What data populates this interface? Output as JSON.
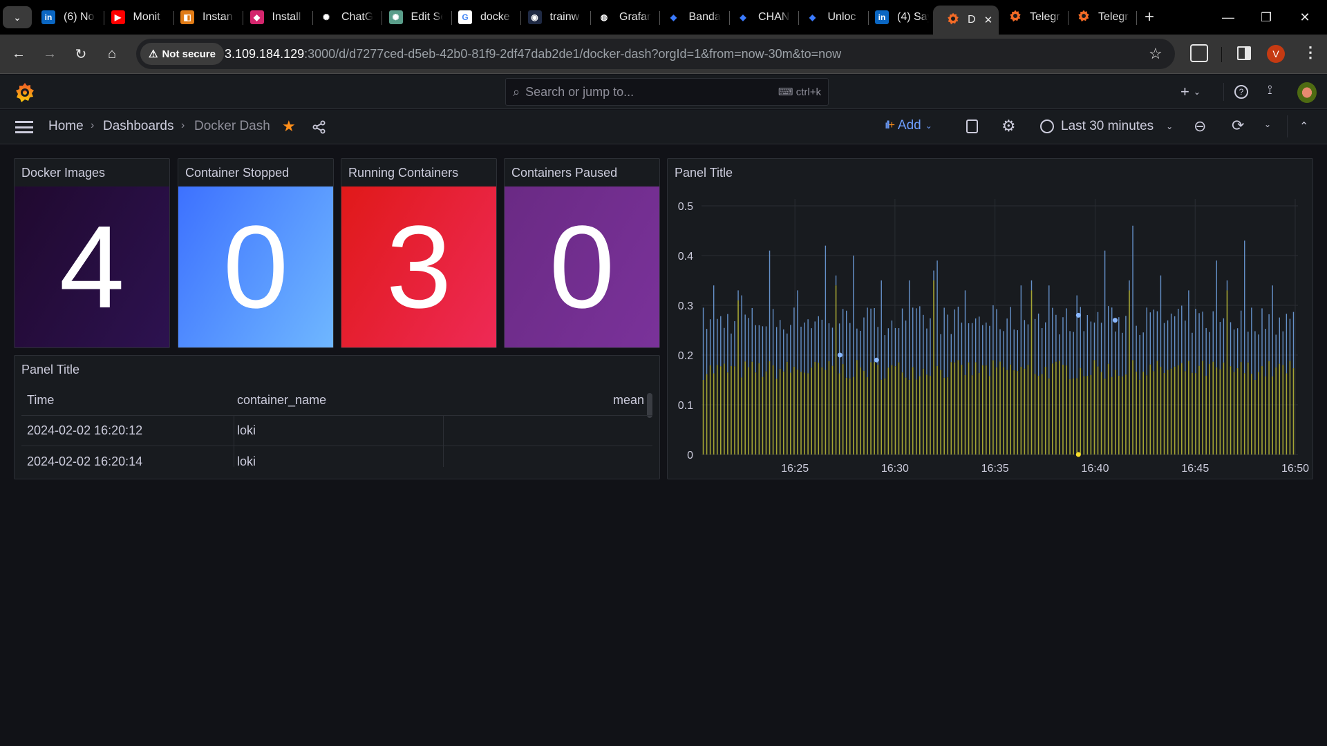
{
  "browser": {
    "tabs": [
      {
        "icon": "linkedin-icon",
        "icon_text": "in",
        "icon_color": "#0a66c2",
        "label": "(6) No"
      },
      {
        "icon": "youtube-icon",
        "icon_text": "▶",
        "icon_color": "#ff0000",
        "label": "Monit"
      },
      {
        "icon": "aws-icon",
        "icon_text": "◧",
        "icon_color": "#e07b16",
        "label": "Instan"
      },
      {
        "icon": "gem-icon",
        "icon_text": "◆",
        "icon_color": "#d4266d",
        "label": "Install"
      },
      {
        "icon": "chatgpt-icon",
        "icon_text": "✺",
        "icon_color": "#000000",
        "label": "ChatG"
      },
      {
        "icon": "chatgpt-icon",
        "icon_text": "✺",
        "icon_color": "#5a9e8a",
        "label": "Edit Se"
      },
      {
        "icon": "google-icon",
        "icon_text": "G",
        "icon_color": "#ffffff",
        "label": "docke"
      },
      {
        "icon": "docker-icon",
        "icon_text": "◉",
        "icon_color": "#1f2a44",
        "label": "trainw"
      },
      {
        "icon": "globe-icon",
        "icon_text": "◍",
        "icon_color": "#000000",
        "label": "Grafan"
      },
      {
        "icon": "diamond-icon",
        "icon_text": "◆",
        "icon_color": "#000000",
        "label": "Banda"
      },
      {
        "icon": "diamond-icon",
        "icon_text": "◆",
        "icon_color": "#000000",
        "label": "CHAN"
      },
      {
        "icon": "diamond-icon",
        "icon_text": "◆",
        "icon_color": "#000000",
        "label": "Unloc"
      },
      {
        "icon": "linkedin-icon",
        "icon_text": "in",
        "icon_color": "#0a66c2",
        "label": "(4) Say"
      }
    ],
    "active_tab": {
      "icon": "grafana-icon",
      "label": "D"
    },
    "right_tabs": [
      {
        "icon": "grafana-icon",
        "label": "Telegr"
      },
      {
        "icon": "grafana-icon",
        "label": "Telegr"
      }
    ],
    "security_label": "Not secure",
    "url_host": "3.109.184.129",
    "url_rest": ":3000/d/d7277ced-d5eb-42b0-81f9-2df47dab2de1/docker-dash?orgId=1&from=now-30m&to=now",
    "profile_initial": "V"
  },
  "grafana": {
    "search_placeholder": "Search or jump to...",
    "search_shortcut": "ctrl+k",
    "breadcrumbs": [
      "Home",
      "Dashboards",
      "Docker Dash"
    ],
    "add_label": "Add",
    "time_range": "Last 30 minutes",
    "star_color": "#ff8f1a"
  },
  "stats": [
    {
      "title": "Docker Images",
      "value": "4",
      "bg_from": "#20092f",
      "bg_to": "#2d1250"
    },
    {
      "title": "Container Stopped",
      "value": "0",
      "bg_from": "#3d71ff",
      "bg_to": "#6fb7ff"
    },
    {
      "title": "Running Containers",
      "value": "3",
      "bg_from": "#e01919",
      "bg_to": "#ee2a56"
    },
    {
      "title": "Containers Paused",
      "value": "0",
      "bg_from": "#6a2a84",
      "bg_to": "#7a329a"
    }
  ],
  "table": {
    "title": "Panel Title",
    "columns": [
      "Time",
      "container_name",
      "mean"
    ],
    "rows": [
      [
        "2024-02-02 16:20:12",
        "loki",
        ""
      ],
      [
        "2024-02-02 16:20:14",
        "loki",
        ""
      ]
    ]
  },
  "chart_data": {
    "type": "bar",
    "title": "Panel Title",
    "xlabel": "",
    "ylabel": "",
    "ylim": [
      0,
      0.5
    ],
    "yticks": [
      "0",
      "0.1",
      "0.2",
      "0.3",
      "0.4",
      "0.5"
    ],
    "xticks": [
      "16:25",
      "16:30",
      "16:35",
      "16:40",
      "16:45",
      "16:50"
    ],
    "x_range": [
      "16:20:20",
      "16:50:00"
    ],
    "grid": true,
    "legend": "none",
    "series": [
      {
        "name": "series-blue",
        "color": "#73a6e8",
        "style": "stacked-top",
        "typical_range": [
          0.24,
          0.3
        ],
        "peaks": [
          0.34,
          0.32,
          0.41,
          0.33,
          0.42,
          0.4,
          0.35,
          0.35,
          0.39,
          0.33,
          0.3,
          0.34,
          0.34,
          0.32,
          0.41,
          0.46,
          0.36,
          0.33,
          0.39,
          0.43,
          0.34
        ]
      },
      {
        "name": "series-yellow",
        "color": "#c8c83a",
        "style": "base",
        "typical_range": [
          0.15,
          0.19
        ],
        "peaks": [
          0.31,
          0.34,
          0.35,
          0.33,
          0.33,
          0.33
        ]
      }
    ],
    "highlighted_points": [
      {
        "time": "16:27:15",
        "value": 0.2,
        "series": "series-blue"
      },
      {
        "time": "16:29:05",
        "value": 0.19,
        "series": "series-blue"
      },
      {
        "time": "16:39:10",
        "value": 0.28,
        "series": "series-blue"
      },
      {
        "time": "16:41:00",
        "value": 0.27,
        "series": "series-blue"
      },
      {
        "time": "16:39:10",
        "value": 0,
        "series": "series-yellow"
      }
    ]
  }
}
